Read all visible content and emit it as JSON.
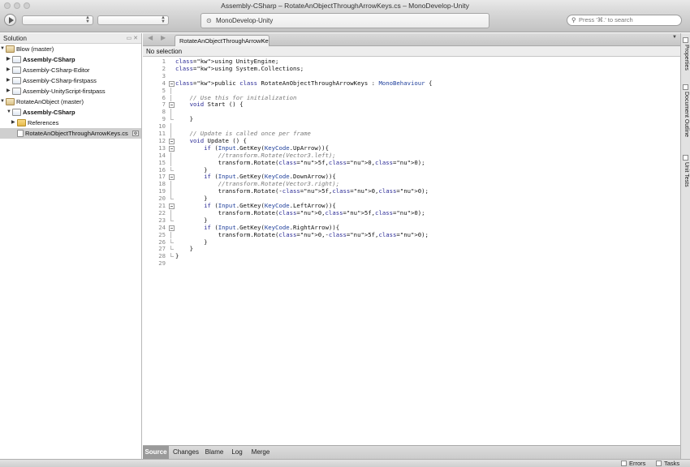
{
  "window": {
    "title": "Assembly-CSharp – RotateAnObjectThroughArrowKeys.cs – MonoDevelop-Unity"
  },
  "toolbar": {
    "config_value": "",
    "platform_value": "",
    "status_text": "MonoDevelop-Unity",
    "search_placeholder": "Press '⌘.' to search"
  },
  "solution_pad": {
    "title": "Solution",
    "items": [
      {
        "label": "Blow (master)",
        "kind": "solution",
        "level": 0,
        "expanded": true
      },
      {
        "label": "Assembly-CSharp",
        "kind": "project",
        "level": 1,
        "expanded": false,
        "bold": true
      },
      {
        "label": "Assembly-CSharp-Editor",
        "kind": "project",
        "level": 1,
        "expanded": false
      },
      {
        "label": "Assembly-CSharp-firstpass",
        "kind": "project",
        "level": 1,
        "expanded": false
      },
      {
        "label": "Assembly-UnityScript-firstpass",
        "kind": "project",
        "level": 1,
        "expanded": false
      },
      {
        "label": "RotateAnObject (master)",
        "kind": "solution",
        "level": 0,
        "expanded": true
      },
      {
        "label": "Assembly-CSharp",
        "kind": "project",
        "level": 1,
        "expanded": true,
        "bold": true
      },
      {
        "label": "References",
        "kind": "folder",
        "level": 2,
        "expanded": false
      },
      {
        "label": "RotateAnObjectThroughArrowKeys.cs",
        "kind": "file",
        "level": 2,
        "selected": true
      }
    ]
  },
  "doc_tab": {
    "label": "RotateAnObjectThroughArrowKeys.cs"
  },
  "pathbar": {
    "text": "No selection"
  },
  "editor": {
    "lines": [
      "using UnityEngine;",
      "using System.Collections;",
      "",
      "public class RotateAnObjectThroughArrowKeys : MonoBehaviour {",
      "",
      "    // Use this for initialization",
      "    void Start () {",
      "",
      "    }",
      "",
      "    // Update is called once per frame",
      "    void Update () {",
      "        if (Input.GetKey(KeyCode.UpArrow)){",
      "            //transform.Rotate(Vector3.left);",
      "            transform.Rotate(5f,0,0);",
      "        }",
      "        if (Input.GetKey(KeyCode.DownArrow)){",
      "            //transform.Rotate(Vector3.right);",
      "            transform.Rotate(-5f,0,0);",
      "        }",
      "        if (Input.GetKey(KeyCode.LeftArrow)){",
      "            transform.Rotate(0,5f,0);",
      "        }",
      "        if (Input.GetKey(KeyCode.RightArrow)){",
      "            transform.Rotate(0,-5f,0);",
      "        }",
      "    }",
      "}",
      ""
    ]
  },
  "bottom_tabs": [
    "Source",
    "Changes",
    "Blame",
    "Log",
    "Merge"
  ],
  "right_dock": {
    "tabs": [
      "Properties",
      "Document Outline",
      "Unit Tests"
    ]
  },
  "statusbar": {
    "errors": "Errors",
    "tasks": "Tasks"
  }
}
